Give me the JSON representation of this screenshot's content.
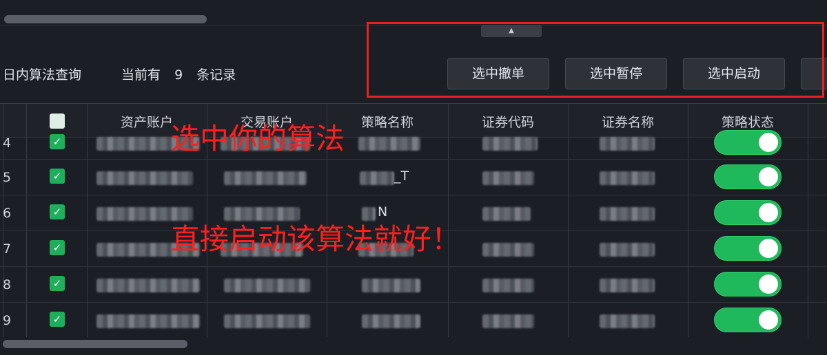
{
  "toolbar": {
    "title": "日内算法查询",
    "count_prefix": "当前有",
    "count_value": "9",
    "count_suffix": "条记录",
    "collapse_icon": "▲",
    "buttons": [
      "选中撤单",
      "选中暂停",
      "选中启动"
    ]
  },
  "table": {
    "columns": [
      "资产账户",
      "交易账户",
      "策略名称",
      "证券代码",
      "证券名称",
      "策略状态"
    ],
    "rows": [
      {
        "num": "4",
        "checked": true,
        "strategy": "",
        "security_code": "",
        "security_name": "",
        "status_on": true
      },
      {
        "num": "5",
        "checked": true,
        "strategy": "_T",
        "security_code": "",
        "security_name": "",
        "status_on": true
      },
      {
        "num": "6",
        "checked": true,
        "strategy": "N",
        "security_code": "",
        "security_name": "",
        "status_on": true
      },
      {
        "num": "7",
        "checked": true,
        "strategy": "",
        "security_code": "",
        "security_name": "",
        "status_on": true
      },
      {
        "num": "8",
        "checked": true,
        "strategy": "",
        "security_code": "",
        "security_name": "",
        "status_on": true
      },
      {
        "num": "9",
        "checked": true,
        "strategy": "",
        "security_code": "",
        "security_name": "",
        "status_on": true
      }
    ]
  },
  "annotations": {
    "line1": "选中你的算法",
    "line2": "直接启动该算法就好！",
    "color": "#e8231f"
  }
}
